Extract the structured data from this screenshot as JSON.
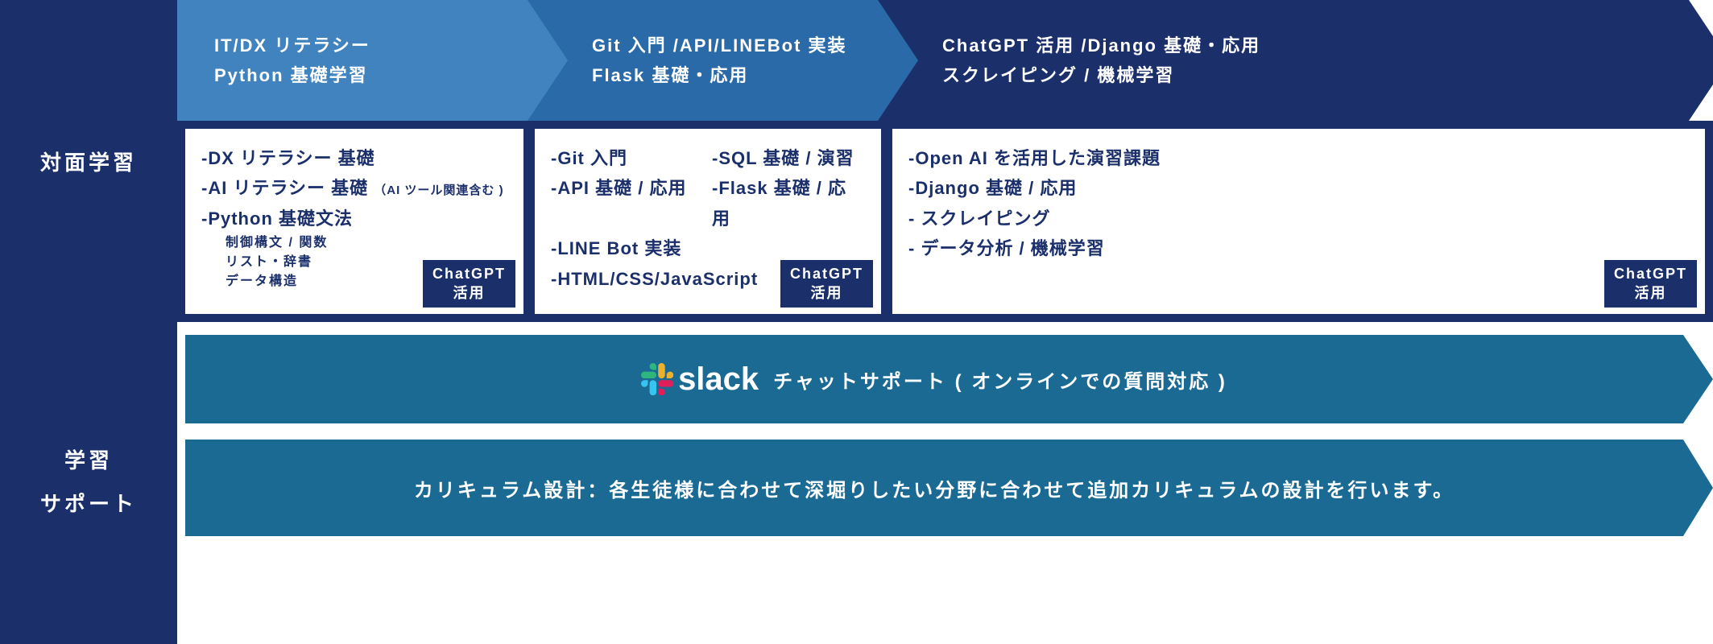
{
  "sidebar": {
    "top": "対面学習",
    "bottom_line1": "学習",
    "bottom_line2": "サポート"
  },
  "phases": {
    "p1": {
      "line1": "IT/DX リテラシー",
      "line2": "Python 基礎学習"
    },
    "p2": {
      "line1": "Git 入門 /API/LINEBot 実装",
      "line2": "Flask 基礎・応用"
    },
    "p3": {
      "line1": "ChatGPT 活用 /Django 基礎・応用",
      "line2": "スクレイピング / 機械学習"
    }
  },
  "cards": {
    "c1": {
      "items": {
        "a": "-DX リテラシー 基礎",
        "b_main": "-AI リテラシー 基礎",
        "b_note": "（AI ツール関連含む )",
        "c": "-Python 基礎文法",
        "c_sub1": "制御構文 / 関数",
        "c_sub2": "リスト・辞書",
        "c_sub3": "データ構造"
      },
      "badge_l1": "ChatGPT",
      "badge_l2": "活用"
    },
    "c2": {
      "items": {
        "a": "-Git 入門",
        "b": "-SQL 基礎 / 演習",
        "c": "-API 基礎 / 応用",
        "d": "-Flask 基礎 / 応用",
        "e": "-LINE Bot 実装",
        "f": "-HTML/CSS/JavaScript"
      },
      "badge_l1": "ChatGPT",
      "badge_l2": "活用"
    },
    "c3": {
      "items": {
        "a": "-Open AI を活用した演習課題",
        "b": "-Django 基礎 / 応用",
        "c": "- スクレイピング",
        "d": "- データ分析 / 機械学習"
      },
      "badge_l1": "ChatGPT",
      "badge_l2": "活用"
    }
  },
  "support": {
    "slack_word": "slack",
    "banner1_text": "チャットサポート ( オンラインでの質問対応 )",
    "banner2_text": "カリキュラム設計：各生徒様に合わせて深堀りしたい分野に合わせて追加カリキュラムの設計を行います。"
  }
}
